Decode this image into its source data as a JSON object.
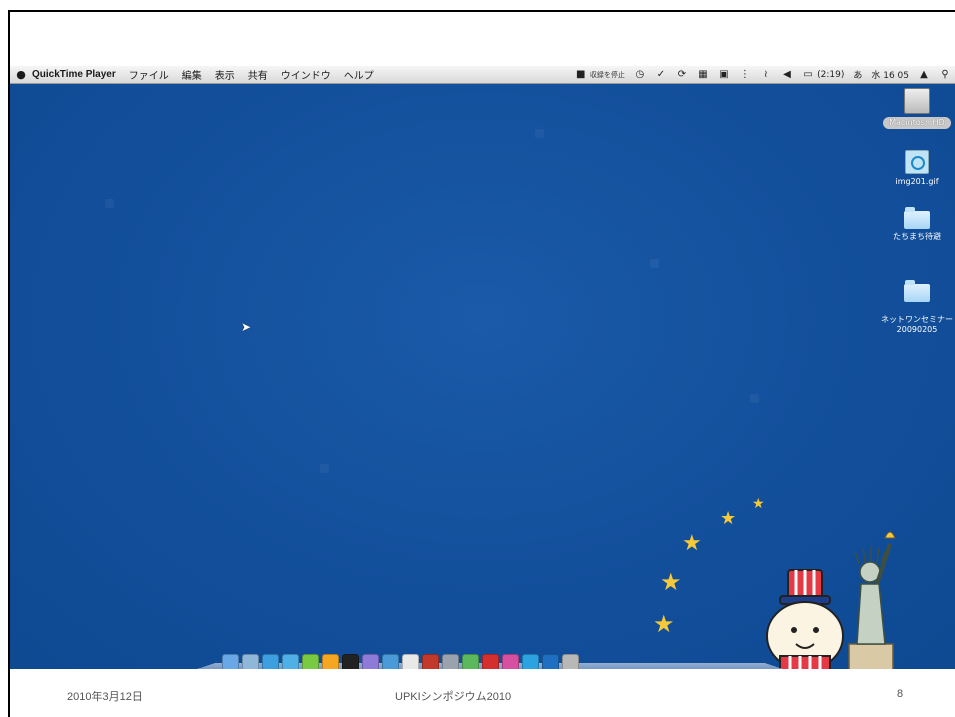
{
  "menubar": {
    "app_name": "QuickTime Player",
    "items": [
      "ファイル",
      "編集",
      "表示",
      "共有",
      "ウインドウ",
      "ヘルプ"
    ],
    "recording_status": "収録を停止",
    "battery_time": "(2:19)",
    "input_method": "あ",
    "clock": "水 16 05"
  },
  "desktop_icons": [
    {
      "label": "Macintosh HD",
      "kind": "hard-drive-icon"
    },
    {
      "label": "img201.gif",
      "kind": "image-file-icon"
    },
    {
      "label": "たちまち待避",
      "kind": "folder-icon"
    },
    {
      "label": "ネットワンセミナー\n20090205",
      "kind": "folder-icon"
    }
  ],
  "dock": {
    "icons": [
      {
        "name": "finder-icon",
        "color": "#6aa7e6"
      },
      {
        "name": "preview-icon",
        "color": "#8fb7d9"
      },
      {
        "name": "safari-icon",
        "color": "#3d9ee0"
      },
      {
        "name": "messenger-icon",
        "color": "#4fb0e8"
      },
      {
        "name": "app-green-icon",
        "color": "#7ac943"
      },
      {
        "name": "pages-icon",
        "color": "#f5a623"
      },
      {
        "name": "terminal-icon",
        "color": "#222222"
      },
      {
        "name": "app-purple-icon",
        "color": "#8e7ad8"
      },
      {
        "name": "itunes-icon",
        "color": "#4a9ad8"
      },
      {
        "name": "ical-icon",
        "color": "#e9e9e9"
      },
      {
        "name": "dictionary-icon",
        "color": "#c0392b"
      },
      {
        "name": "system-preferences-icon",
        "color": "#9aa3ad"
      },
      {
        "name": "app-chart-icon",
        "color": "#5cb85c"
      },
      {
        "name": "en-icon",
        "color": "#d32f2f"
      },
      {
        "name": "app-colorful-icon",
        "color": "#d64fa0"
      },
      {
        "name": "skype-icon",
        "color": "#2ba3e0"
      },
      {
        "name": "quicktime-icon",
        "color": "#1e6fc2"
      },
      {
        "name": "trash-icon",
        "color": "#b8b8b8"
      }
    ]
  },
  "footer": {
    "date": "2010年3月12日",
    "title": "UPKIシンポジウム2010",
    "page": "8"
  },
  "colors": {
    "desktop": "#124e9a",
    "star": "#f5c93a"
  }
}
